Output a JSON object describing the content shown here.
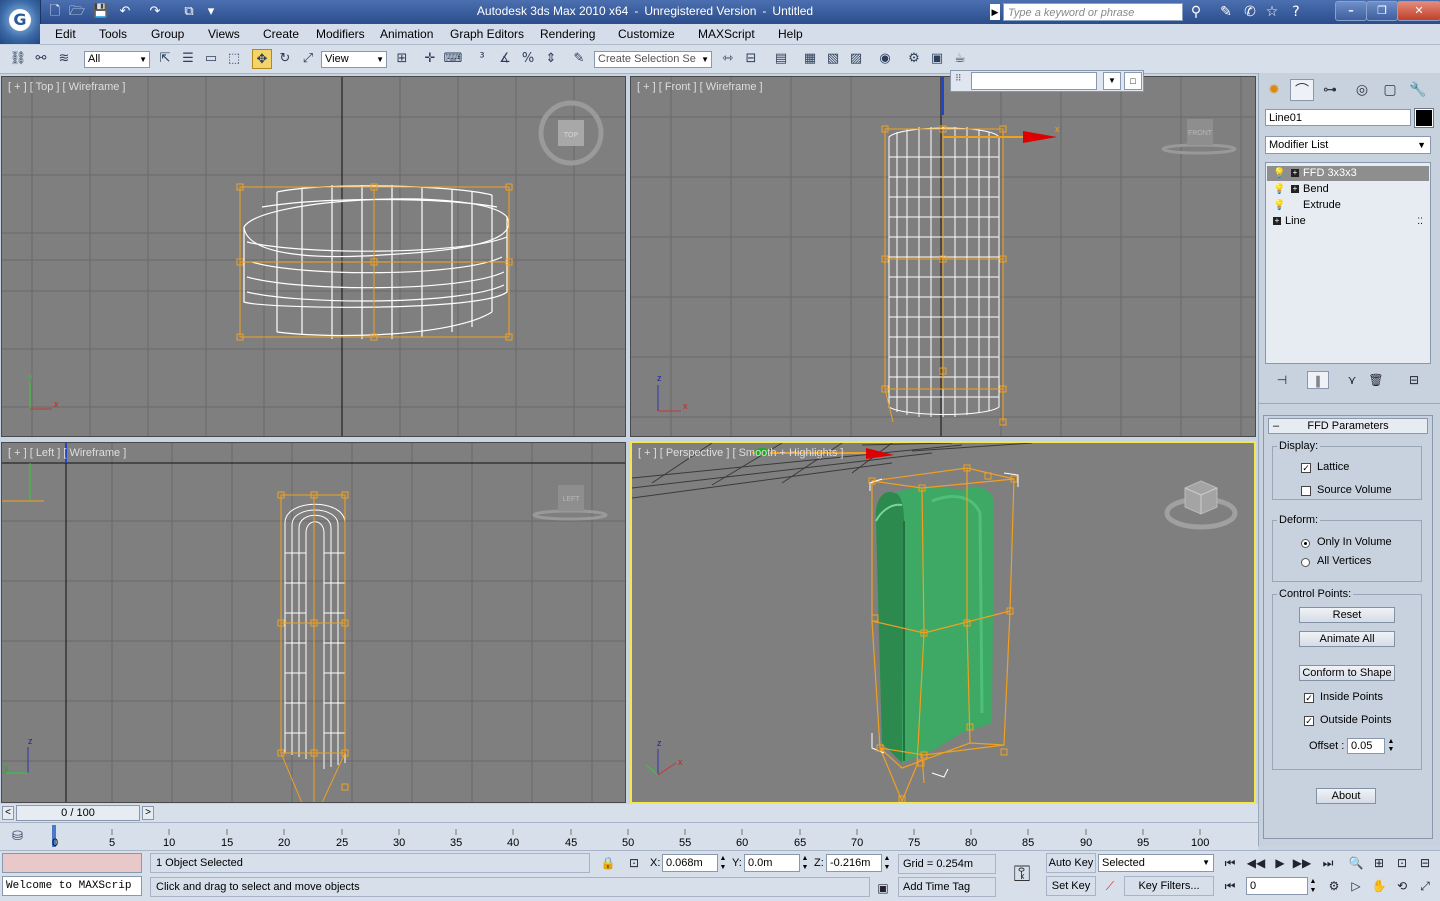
{
  "title_bar": {
    "app_name": "Autodesk 3ds Max  2010 x64",
    "separator1": "-",
    "license": "Unregistered Version",
    "separator2": "-",
    "file": "Untitled",
    "search_placeholder": "Type a keyword or phrase"
  },
  "menus": [
    "Edit",
    "Tools",
    "Group",
    "Views",
    "Create",
    "Modifiers",
    "Animation",
    "Graph Editors",
    "Rendering",
    "Customize",
    "MAXScript",
    "Help"
  ],
  "toolbar": {
    "filter_value": "All",
    "coord_system": "View",
    "selection_set_placeholder": "Create Selection Se"
  },
  "viewports": {
    "top": {
      "label": "[ + ] [ Top ] [ Wireframe ]",
      "cube_label": "TOP"
    },
    "front": {
      "label": "[ + ] [ Front ] [ Wireframe ]",
      "cube_label": "FRONT"
    },
    "left": {
      "label": "[ + ] [ Left ] [ Wireframe ]",
      "cube_label": "LEFT"
    },
    "perspective": {
      "label": "[ + ] [ Perspective ] [ Smooth + Highlights ]"
    }
  },
  "axes": {
    "x": "x",
    "y": "y",
    "z": "z"
  },
  "command_panel": {
    "object_name": "Line01",
    "modifier_list": "Modifier List",
    "stack": [
      "FFD 3x3x3",
      "Bend",
      "Extrude",
      "Line"
    ],
    "rollout_title": "FFD Parameters",
    "display_group": "Display:",
    "lattice": "Lattice",
    "source_volume": "Source Volume",
    "deform_group": "Deform:",
    "only_in_volume": "Only In Volume",
    "all_vertices": "All Vertices",
    "control_points_group": "Control Points:",
    "reset_btn": "Reset",
    "animate_all_btn": "Animate All",
    "conform_btn": "Conform to Shape",
    "inside_points": "Inside Points",
    "outside_points": "Outside Points",
    "offset_label": "Offset :",
    "offset_value": "0.05",
    "about_btn": "About"
  },
  "time_slider": {
    "position": "0 / 100",
    "prev": "<",
    "next": ">"
  },
  "trackbar_ticks": [
    "0",
    "5",
    "10",
    "15",
    "20",
    "25",
    "30",
    "35",
    "40",
    "45",
    "50",
    "55",
    "60",
    "65",
    "70",
    "75",
    "80",
    "85",
    "90",
    "95",
    "100"
  ],
  "status": {
    "maxscript_listener": "Welcome to MAXScrip",
    "selection_status": "1 Object Selected",
    "prompt": "Click and drag to select and move objects",
    "x_label": "X:",
    "x_value": "0.068m",
    "y_label": "Y:",
    "y_value": "0.0m",
    "z_label": "Z:",
    "z_value": "-0.216m",
    "grid": "Grid = 0.254m",
    "add_time_tag": "Add Time Tag",
    "auto_key": "Auto Key",
    "set_key": "Set Key",
    "key_mode": "Selected",
    "key_filters": "Key Filters...",
    "frame": "0"
  },
  "colors": {
    "viewport_bg": "#7f7f7f",
    "selection_gizmo": "#f0a020",
    "mesh_wire": "#ffffff",
    "mesh_shaded": "#3aa060",
    "active_border": "#f4e64c"
  }
}
